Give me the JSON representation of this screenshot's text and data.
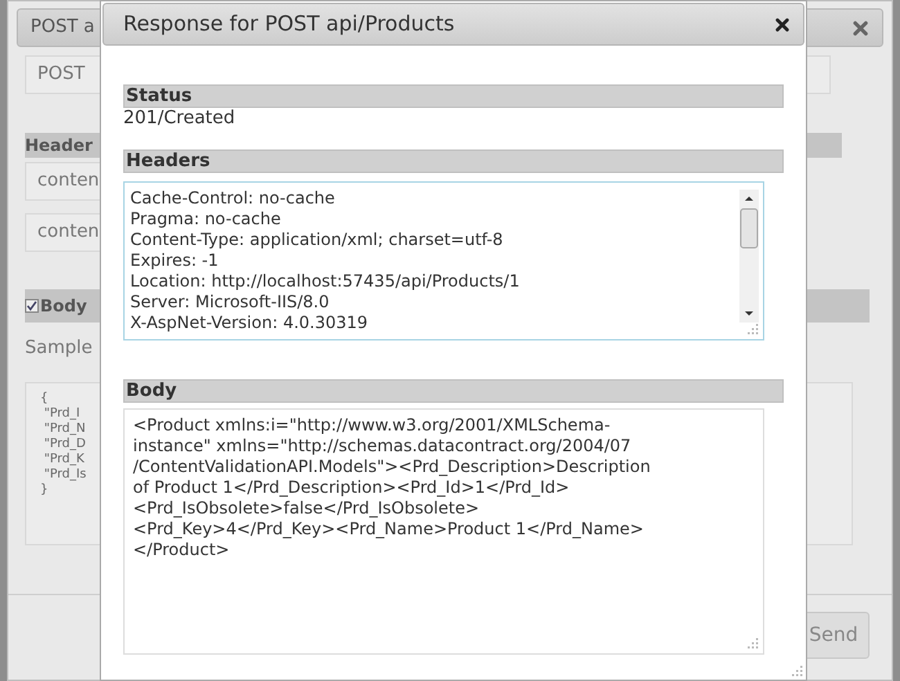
{
  "background_dialog": {
    "title": "POST a",
    "method": "POST",
    "headers_label": "Header",
    "header_fields": [
      "conten",
      "conten"
    ],
    "body_section": {
      "label": "Body",
      "checked": true
    },
    "sample_label": "Sample",
    "sample_lines": [
      "{",
      " \"Prd_I",
      " \"Prd_N",
      " \"Prd_D",
      " \"Prd_K",
      " \"Prd_Is",
      "}"
    ],
    "send_button": "Send"
  },
  "response_dialog": {
    "title": "Response for POST api/Products",
    "status_label": "Status",
    "status": "201/Created",
    "headers_label": "Headers",
    "headers": [
      "Cache-Control: no-cache",
      "Pragma: no-cache",
      "Content-Type: application/xml; charset=utf-8",
      "Expires: -1",
      "Location: http://localhost:57435/api/Products/1",
      "Server: Microsoft-IIS/8.0",
      "X-AspNet-Version: 4.0.30319"
    ],
    "body_label": "Body",
    "body": [
      "<Product xmlns:i=\"http://www.w3.org/2001/XMLSchema-",
      "instance\" xmlns=\"http://schemas.datacontract.org/2004/07",
      "/ContentValidationAPI.Models\"><Prd_Description>Description",
      "of Product 1</Prd_Description><Prd_Id>1</Prd_Id>",
      "<Prd_IsObsolete>false</Prd_IsObsolete>",
      "<Prd_Key>4</Prd_Key><Prd_Name>Product 1</Prd_Name>",
      "</Product>"
    ]
  }
}
